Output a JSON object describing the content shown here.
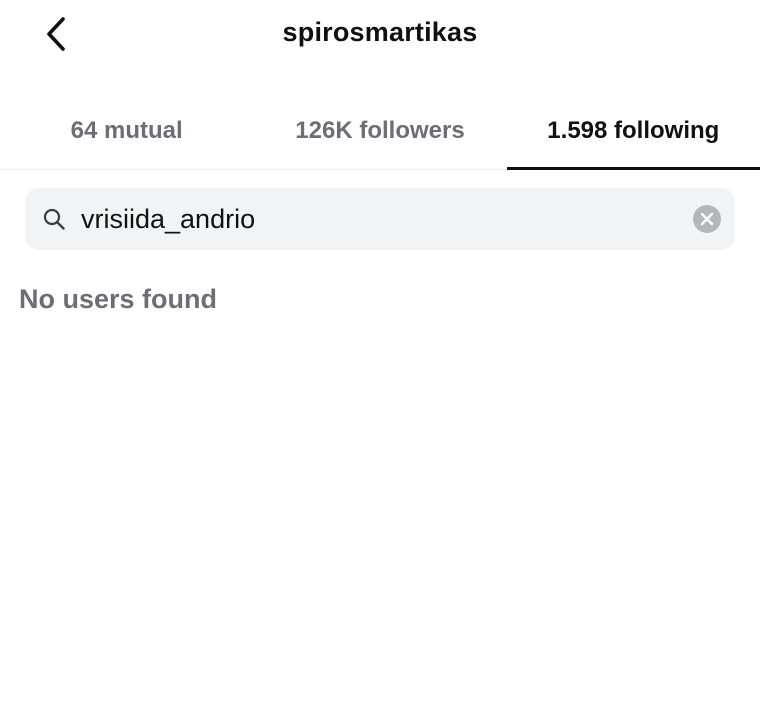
{
  "header": {
    "title": "spirosmartikas",
    "back_icon": "chevron-left-icon"
  },
  "tabs": [
    {
      "label": "64 mutual",
      "active": false
    },
    {
      "label": "126K followers",
      "active": false
    },
    {
      "label": "1.598 following",
      "active": true
    }
  ],
  "search": {
    "icon": "search-icon",
    "value": "vrisiida_andrio",
    "clear_icon": "clear-circle-icon"
  },
  "results": {
    "empty_message": "No users found"
  },
  "colors": {
    "text_primary": "#111111",
    "text_secondary": "#6b6f75",
    "search_background": "#f2f3f5",
    "clear_icon": "#b3b6bb"
  }
}
